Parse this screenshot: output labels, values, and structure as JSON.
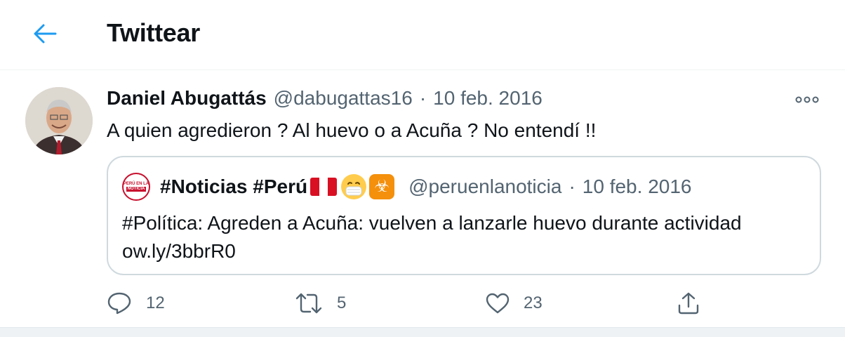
{
  "header": {
    "title": "Twittear",
    "back_icon": "arrow-left-icon",
    "accent_color": "#1d9bf0"
  },
  "tweet": {
    "author_name": "Daniel Abugattás",
    "author_handle": "@dabugattas16",
    "separator": "·",
    "date": "10 feb. 2016",
    "text": "A quien agredieron ? Al huevo o a Acuña ? No entendí !!",
    "more_icon": "more-horizontal-icon"
  },
  "quote": {
    "author_name": "#Noticias #Perú",
    "author_handle": "@peruenlanoticia",
    "separator": "·",
    "date": "10 feb. 2016",
    "text": "#Política: Agreden a Acuña: vuelven a lanzarle huevo durante actividad ow.ly/3bbrR0",
    "avatar_text_top": "PERÚ EN LA",
    "avatar_text_bottom": "NOTICIA",
    "emojis": [
      "peru-flag-icon",
      "face-mask-icon",
      "biohazard-icon"
    ]
  },
  "actions": {
    "reply_count": "12",
    "retweet_count": "5",
    "like_count": "23",
    "icon_color": "#536471"
  }
}
